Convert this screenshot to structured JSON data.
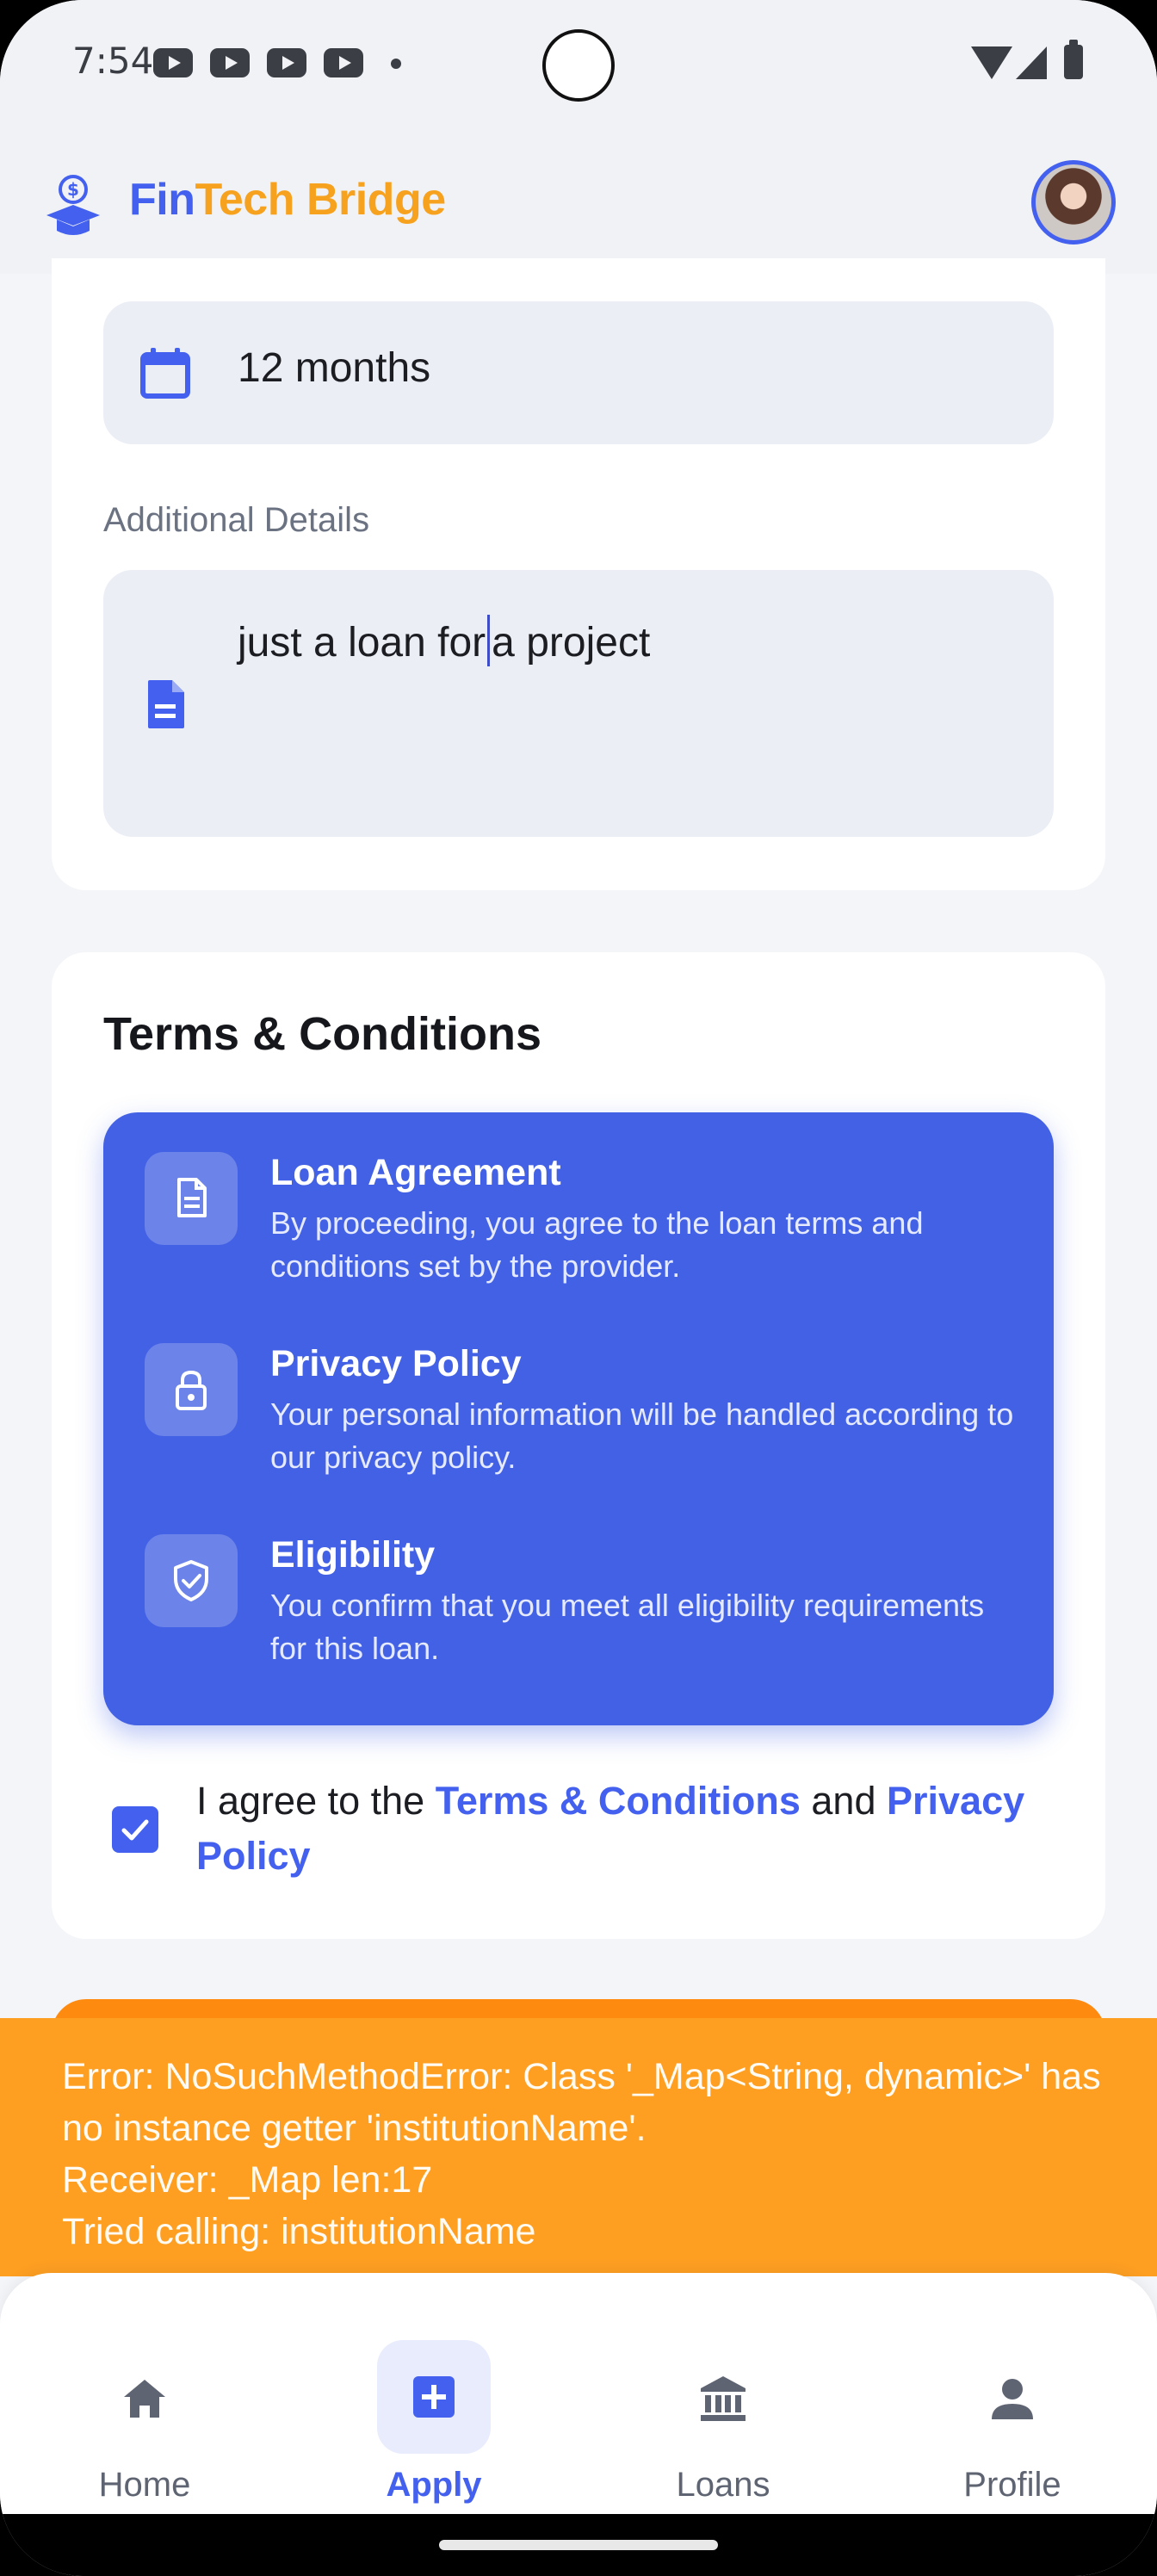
{
  "status_bar": {
    "time": "7:54",
    "notification_icons": [
      "youtube-icon",
      "youtube-icon",
      "youtube-icon",
      "youtube-icon"
    ],
    "system_icons": [
      "wifi-icon",
      "signal-icon",
      "battery-icon"
    ]
  },
  "header": {
    "brand_part1": "Fin",
    "brand_part2": "Tech Bridge",
    "logo_icon": "money-graduation-icon",
    "avatar": "user-avatar"
  },
  "form": {
    "duration_value": "12 months",
    "details_label": "Additional Details",
    "details_before_cursor": "just a loan for",
    "details_after_cursor": "a project"
  },
  "terms": {
    "title": "Terms & Conditions",
    "items": [
      {
        "icon": "document-icon",
        "title": "Loan Agreement",
        "desc": "By proceeding, you agree to the loan terms and conditions set by the provider."
      },
      {
        "icon": "lock-icon",
        "title": "Privacy Policy",
        "desc": "Your personal information will be handled according to our privacy policy."
      },
      {
        "icon": "shield-check-icon",
        "title": "Eligibility",
        "desc": "You confirm that you meet all eligibility requirements for this loan."
      }
    ],
    "agree_prefix": "I agree to the ",
    "agree_link1": "Terms & Conditions",
    "agree_mid": " and ",
    "agree_link2": "Privacy Policy",
    "agree_checked": true
  },
  "error": {
    "message": "Error: NoSuchMethodError: Class '_Map<String, dynamic>' has no instance getter 'institutionName'.\nReceiver: _Map len:17\nTried calling: institutionName"
  },
  "nav": {
    "items": [
      {
        "label": "Home",
        "icon": "home-icon",
        "active": false
      },
      {
        "label": "Apply",
        "icon": "add-box-icon",
        "active": true
      },
      {
        "label": "Loans",
        "icon": "bank-icon",
        "active": false
      },
      {
        "label": "Profile",
        "icon": "person-icon",
        "active": false
      }
    ]
  },
  "colors": {
    "primary": "#4361ee",
    "accent_orange": "#f6a21e",
    "error_banner": "#fe9f22",
    "terms_box": "#4361e4"
  }
}
